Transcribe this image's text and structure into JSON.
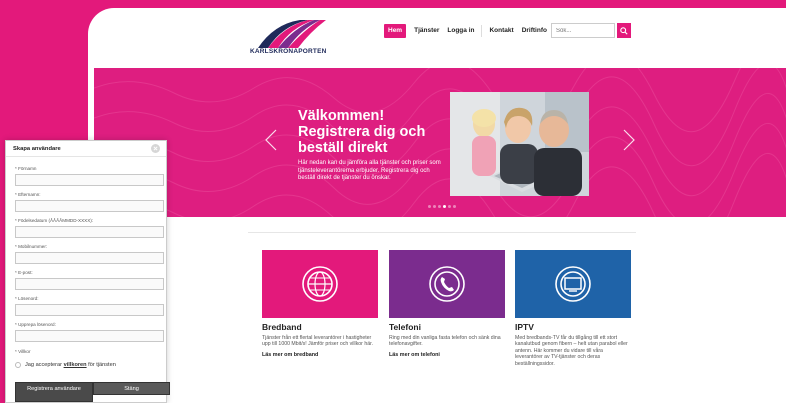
{
  "header": {
    "logo_text": "KARLSKRONAPORTEN",
    "nav": [
      "Hem",
      "Tjänster",
      "Logga in",
      "Kontakt",
      "Driftinfo"
    ],
    "search_placeholder": "Sök..."
  },
  "hero": {
    "title": "Välkommen! Registrera dig och beställ direkt",
    "text": "Här nedan kan du jämföra alla tjänster och priser som tjänsteleverantörerna erbjuder. Registrera dig och beställ direkt de tjänster du önskar.",
    "dot_count": 6,
    "active_dot": 3
  },
  "services": [
    {
      "title": "Bredband",
      "text": "Tjänster från ett flertal leverantörer i hastigheter upp till 1000 Mbit/s! Jämför priser och villkor här.",
      "link": "Läs mer om bredband",
      "color": "#e3197b",
      "icon": "globe-icon"
    },
    {
      "title": "Telefoni",
      "text": "Ring med din vanliga fasta telefon och sänk dina telefonavgifter.",
      "link": "Läs mer om telefoni",
      "color": "#7b2c8e",
      "icon": "phone-icon"
    },
    {
      "title": "IPTV",
      "text": "Med bredbands-TV får du tillgång till ett stort kanalutbud genom fibern – helt utan parabol eller antenn. Här kommer du vidare till våra leverantörer av TV-tjänster och deras beställningssidor.",
      "link": "",
      "color": "#1f63a8",
      "icon": "tv-icon"
    }
  ],
  "modal": {
    "title": "Skapa användare",
    "fields": [
      {
        "label": "* Förnamn"
      },
      {
        "label": "* Efternamn:"
      },
      {
        "label": "* Födelsedatum (ÅÅÅÅMMDD-XXXX):"
      },
      {
        "label": "* Mobilnummer:"
      },
      {
        "label": "* E-post:"
      },
      {
        "label": "* Lösenord:"
      },
      {
        "label": "* Upprepa lösenord:"
      }
    ],
    "terms_heading": "* Villkor",
    "terms_prefix": "Jag accepterar",
    "terms_link": "villkoren",
    "terms_suffix": "för tjänsten",
    "register_label": "Registrera användare",
    "close_label": "Stäng"
  }
}
